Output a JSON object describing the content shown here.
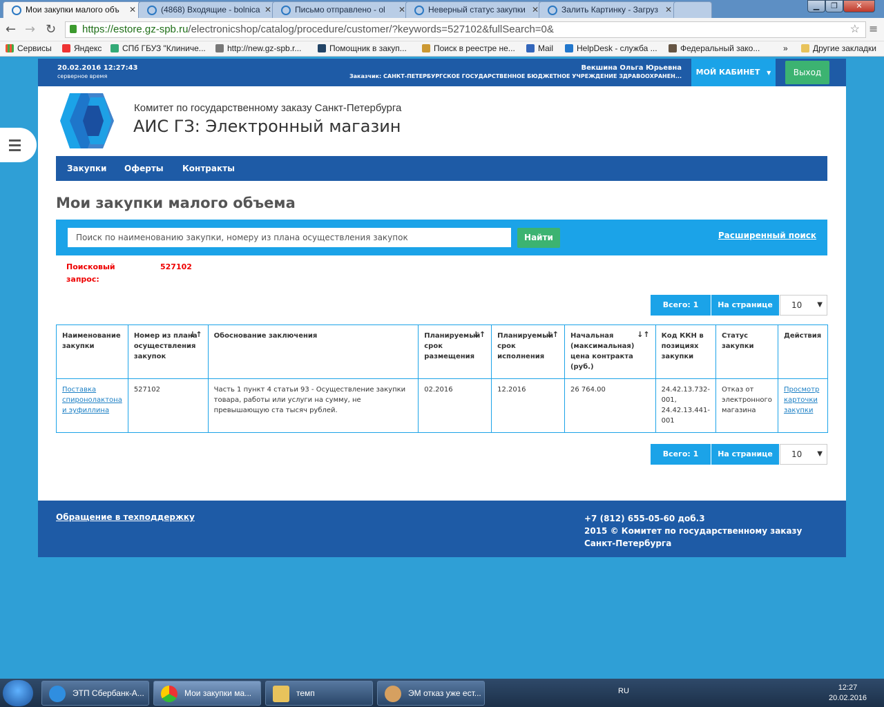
{
  "browser": {
    "tabs": [
      {
        "label": "Мои закупки малого объ"
      },
      {
        "label": "(4868) Входящие - bolnica"
      },
      {
        "label": "Письмо отправлено - ol"
      },
      {
        "label": "Неверный статус закупки"
      },
      {
        "label": "Залить Картинку - Загруз"
      }
    ],
    "url_host": "https://estore.gz-spb.ru",
    "url_path": "/electronicshop/catalog/procedure/customer/?keywords=527102&fullSearch=0&",
    "bookmarks": [
      "Сервисы",
      "Яндекс",
      "СПб ГБУЗ \"Клиниче...",
      "http://new.gz-spb.r...",
      "Помощник в закуп...",
      "Поиск в реестре не...",
      "Mail",
      "HelpDesk - служба ...",
      "Федеральный зако..."
    ],
    "bookmarks_more": "»",
    "other_bookmarks": "Другие закладки"
  },
  "topbar": {
    "datetime": "20.02.2016 12:27:43",
    "server_time": "серверное время",
    "user": "Векшина Ольга Юрьевна",
    "customer": "Заказчик: САНКТ-ПЕТЕРБУРГСКОЕ ГОСУДАРСТВЕННОЕ БЮДЖЕТНОЕ УЧРЕЖДЕНИЕ ЗДРАВООХРАНЕН...",
    "cabinet": "МОЙ КАБИНЕТ",
    "exit": "Выход"
  },
  "header": {
    "org": "Комитет по государственному заказу Санкт-Петербурга",
    "app": "АИС ГЗ: Электронный магазин"
  },
  "menu": [
    "Закупки",
    "Оферты",
    "Контракты"
  ],
  "page_title": "Мои закупки малого объема",
  "search": {
    "placeholder": "Поиск по наименованию закупки, номеру из плана осуществления закупок",
    "button": "Найти",
    "advanced": "Расширенный поиск",
    "query_label": "Поисковый запрос:",
    "query_value": "527102"
  },
  "pagination": {
    "total": "Всего: 1",
    "per_page": "На странице",
    "per_page_value": "10"
  },
  "table": {
    "headers": [
      "Наименование закупки",
      "Номер из плана осуществления закупок",
      "Обоснование заключения",
      "Планируемый срок размещения",
      "Планируемый срок исполнения",
      "Начальная (максимальная) цена контракта (руб.)",
      "Код ККН в позициях закупки",
      "Статус закупки",
      "Действия"
    ],
    "rows": [
      {
        "name": "Поставка спиронолактона и эуфиллина",
        "plan_number": "527102",
        "basis": "Часть 1 пункт 4 статьи 93 - Осуществление закупки товара, работы или услуги на сумму, не превышающую ста тысяч рублей.",
        "placement": "02.2016",
        "execution": "12.2016",
        "price": "26 764.00",
        "kkn": "24.42.13.732-001, 24.42.13.441-001",
        "status": "Отказ от электронного магазина",
        "action": "Просмотр карточки закупки"
      }
    ]
  },
  "footer": {
    "support": "Обращение в техподдержку",
    "phone": "+7 (812) 655-05-60 доб.3",
    "copyright": "2015 © Комитет по государственному заказу Санкт-Петербурга"
  },
  "taskbar": {
    "items": [
      "ЭТП Сбербанк-А...",
      "Мои закупки ма...",
      "темп",
      "ЭМ отказ уже ест..."
    ],
    "lang": "RU",
    "time": "12:27",
    "date": "20.02.2016"
  }
}
